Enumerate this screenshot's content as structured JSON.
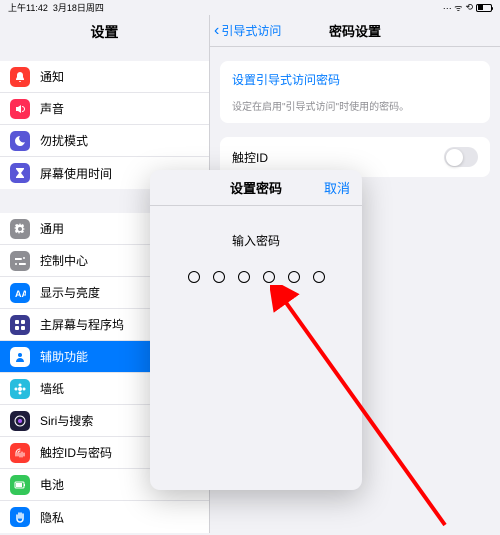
{
  "status": {
    "time": "上午11:42",
    "date": "3月18日周四"
  },
  "sidebar": {
    "title": "设置",
    "groups": [
      {
        "items": [
          {
            "label": "通知",
            "color": "#ff3b30",
            "icon": "bell"
          },
          {
            "label": "声音",
            "color": "#ff2d55",
            "icon": "sound"
          },
          {
            "label": "勿扰模式",
            "color": "#5856d6",
            "icon": "moon"
          },
          {
            "label": "屏幕使用时间",
            "color": "#5856d6",
            "icon": "hourglass"
          }
        ]
      },
      {
        "items": [
          {
            "label": "通用",
            "color": "#8e8e93",
            "icon": "gear"
          },
          {
            "label": "控制中心",
            "color": "#8e8e93",
            "icon": "switches"
          },
          {
            "label": "显示与亮度",
            "color": "#007aff",
            "icon": "aa"
          },
          {
            "label": "主屏幕与程序坞",
            "color": "#3a3a8f",
            "icon": "grid"
          },
          {
            "label": "辅助功能",
            "color": "#007aff",
            "icon": "person",
            "active": true
          },
          {
            "label": "墙纸",
            "color": "#27bdde",
            "icon": "flower"
          },
          {
            "label": "Siri与搜索",
            "color": "#1e1c3a",
            "icon": "siri"
          },
          {
            "label": "触控ID与密码",
            "color": "#ff3b30",
            "icon": "fingerprint"
          },
          {
            "label": "电池",
            "color": "#34c759",
            "icon": "battery"
          },
          {
            "label": "隐私",
            "color": "#007aff",
            "icon": "hand"
          }
        ]
      }
    ]
  },
  "detail": {
    "back": "引导式访问",
    "title": "密码设置",
    "set_link": "设置引导式访问密码",
    "set_sub": "设定在启用\"引导式访问\"时使用的密码。",
    "touch_id": "触控ID"
  },
  "modal": {
    "title": "设置密码",
    "cancel": "取消",
    "prompt": "输入密码",
    "digits": 6
  }
}
